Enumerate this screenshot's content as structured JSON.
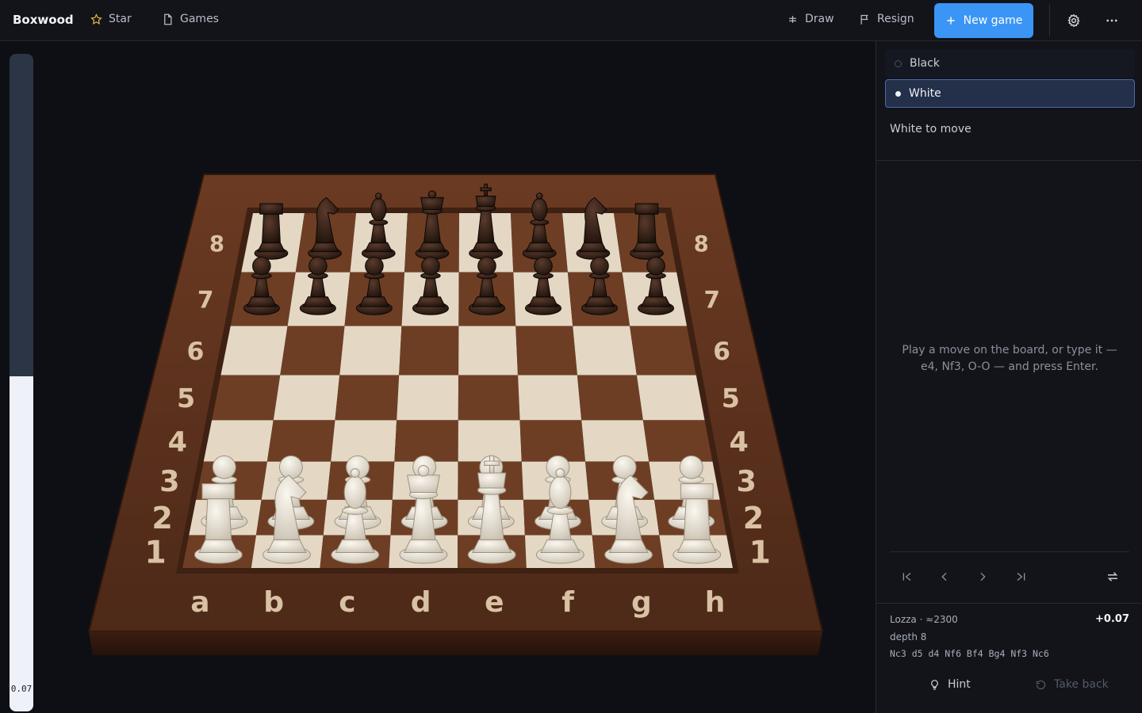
{
  "app": {
    "brand": "Boxwood"
  },
  "topbar": {
    "star_label": "Star",
    "games_label": "Games",
    "draw_label": "Draw",
    "resign_label": "Resign",
    "new_game_label": "New game"
  },
  "colors": {
    "accent": "#3b95f5",
    "light_square": "#e4d8c4",
    "dark_square": "#6e3e24",
    "frame": "#5a311d"
  },
  "eval": {
    "label": "0.07",
    "white_fraction": 0.51
  },
  "board": {
    "files": [
      "a",
      "b",
      "c",
      "d",
      "e",
      "f",
      "g",
      "h"
    ],
    "ranks": [
      "1",
      "2",
      "3",
      "4",
      "5",
      "6",
      "7",
      "8"
    ],
    "position": [
      [
        "r",
        "n",
        "b",
        "q",
        "k",
        "b",
        "n",
        "r"
      ],
      [
        "p",
        "p",
        "p",
        "p",
        "p",
        "p",
        "p",
        "p"
      ],
      [
        "",
        "",
        "",
        "",
        "",
        "",
        "",
        ""
      ],
      [
        "",
        "",
        "",
        "",
        "",
        "",
        "",
        ""
      ],
      [
        "",
        "",
        "",
        "",
        "",
        "",
        "",
        ""
      ],
      [
        "",
        "",
        "",
        "",
        "",
        "",
        "",
        ""
      ],
      [
        "P",
        "P",
        "P",
        "P",
        "P",
        "P",
        "P",
        "P"
      ],
      [
        "R",
        "N",
        "B",
        "Q",
        "K",
        "B",
        "N",
        "R"
      ]
    ]
  },
  "panel": {
    "side_options": [
      "Black",
      "White"
    ],
    "selected_side": "White",
    "to_move": "White to move",
    "hint_text": "Play a move on the board, or type it — e4, Nf3, O-O — and press Enter.",
    "engine": "Lozza · ≈2300",
    "score": "+0.07",
    "depth": "depth 8",
    "pv": "Nc3 d5 d4 Nf6 Bf4 Bg4 Nf3 Nc6",
    "hint_label": "Hint",
    "takeback_label": "Take back"
  }
}
